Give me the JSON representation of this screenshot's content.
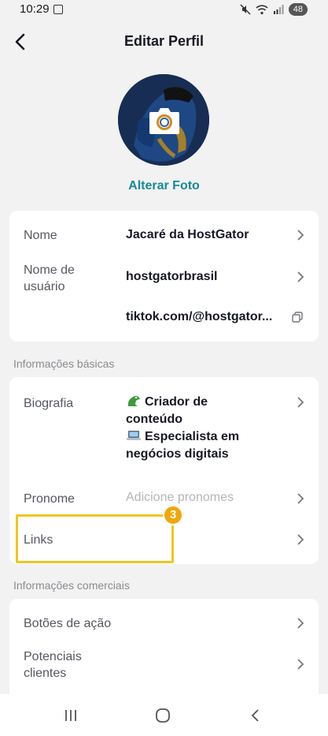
{
  "status_bar": {
    "time": "10:29",
    "battery": "48"
  },
  "header": {
    "title": "Editar Perfil"
  },
  "avatar": {
    "change_photo_label": "Alterar Foto"
  },
  "profile_card": {
    "name_label": "Nome",
    "name_value": "Jacaré da HostGator",
    "username_label_1": "Nome de",
    "username_label_2": "usuário",
    "username_value": "hostgatorbrasil",
    "link_value": "tiktok.com/@hostgator..."
  },
  "basic_info": {
    "section_title": "Informações básicas",
    "bio_label": "Biografia",
    "bio_line_1": "Criador de",
    "bio_line_2": "conteúdo",
    "bio_line_3": "Especialista em",
    "bio_line_4": "negócios digitais",
    "pronoun_label": "Pronome",
    "pronoun_placeholder": "Adicione pronomes",
    "links_label": "Links"
  },
  "annotation": {
    "step": "3",
    "color": "#f2c520",
    "badge_color": "#f2a60a"
  },
  "business_info": {
    "section_title": "Informações comerciais",
    "action_buttons_label": "Botões de ação",
    "leads_label_1": "Potenciais",
    "leads_label_2": "clientes"
  },
  "icons": [
    "screenshot-icon",
    "mute-icon",
    "wifi-icon",
    "signal-icon",
    "back-icon",
    "camera-icon",
    "chevron-right-icon",
    "copy-icon",
    "recent-apps-icon",
    "home-icon",
    "nav-back-icon"
  ],
  "colors": {
    "accent": "#178a96",
    "text": "#161823",
    "muted": "#555861",
    "background": "#f2f2f2"
  }
}
